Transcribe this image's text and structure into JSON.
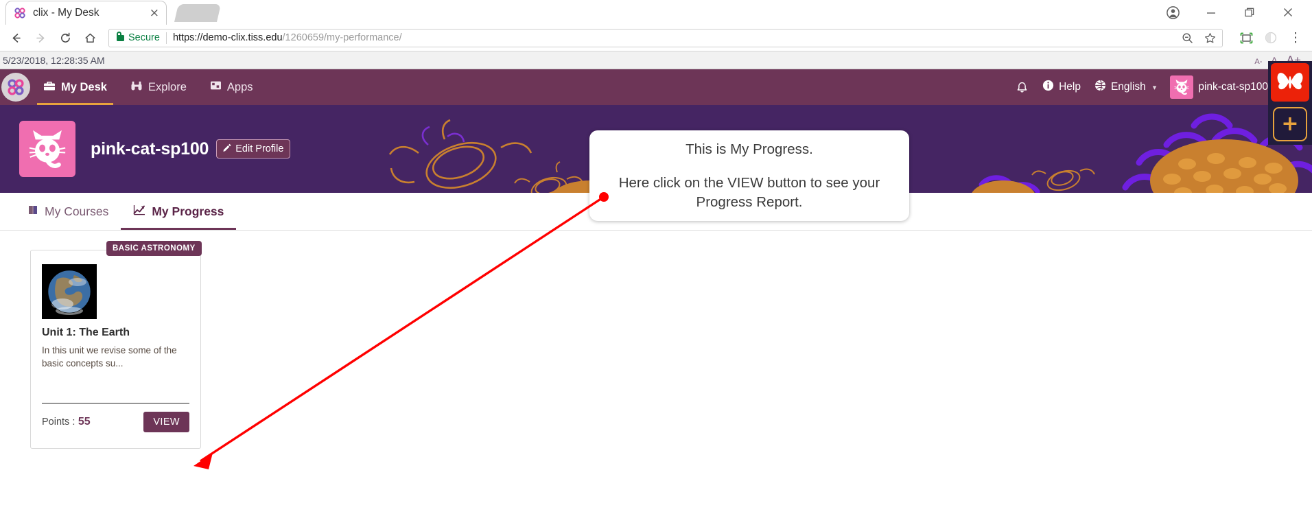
{
  "browser": {
    "tab": {
      "title": "clix - My Desk",
      "favicon": "clix-logo-icon",
      "close": "×"
    },
    "new_tab_button": "new-tab",
    "window_controls": {
      "profile": "●",
      "minimize": "—",
      "maximize": "❐",
      "close": "✕"
    },
    "toolbar": {
      "back": "←",
      "forward": "→",
      "reload": "⟳",
      "home": "⌂",
      "secure_label": "Secure",
      "url_scheme_host": "https://demo-clix.tiss.edu",
      "url_path": "/1260659/my-performance/",
      "url_full": "https://demo-clix.tiss.edu/1260659/my-performance/",
      "zoom_out": "⊖",
      "bookmark": "☆",
      "screenshot": "⬚",
      "extension": "◑",
      "menu": "⋮"
    }
  },
  "status_strip": {
    "timestamp": "5/23/2018, 12:28:35 AM",
    "font_small": "A-",
    "font_normal": "A",
    "font_large": "A+"
  },
  "app_nav": {
    "logo": "clix-logo-icon",
    "items": [
      {
        "label": "My Desk",
        "icon": "briefcase-icon",
        "active": true
      },
      {
        "label": "Explore",
        "icon": "binoculars-icon",
        "active": false
      },
      {
        "label": "Apps",
        "icon": "apps-icon",
        "active": false
      }
    ],
    "notifications_icon": "bell-icon",
    "help_label": "Help",
    "help_icon": "info-icon",
    "language_label": "English",
    "language_icon": "globe-icon",
    "language_caret": "▾",
    "username": "pink-cat-sp100",
    "avatar": "pink-cat-avatar"
  },
  "banner": {
    "avatar": "pink-cat-avatar",
    "profile_name": "pink-cat-sp100",
    "edit_profile_label": "Edit Profile",
    "edit_profile_icon": "pencil-icon",
    "background_color": "#452563"
  },
  "callout": {
    "line1": "This is My Progress.",
    "line2": "Here click on the VIEW button to see your Progress Report.",
    "arrow_color": "#ff0000"
  },
  "page_tabs": [
    {
      "label": "My Courses",
      "icon": "book-icon",
      "active": false
    },
    {
      "label": "My Progress",
      "icon": "chart-line-icon",
      "active": true
    }
  ],
  "course_cards": [
    {
      "badge": "BASIC ASTRONOMY",
      "thumbnail": "earth-image",
      "title": "Unit 1: The Earth",
      "description": "In this unit we revise some of the basic concepts su...",
      "points_label": "Points :",
      "points_value": "55",
      "view_label": "VIEW"
    }
  ],
  "float_widget": {
    "butterfly_icon": "butterfly-icon",
    "add_label": "+"
  },
  "colors": {
    "nav_purple": "#6d3557",
    "banner_purple": "#452563",
    "accent_orange": "#e8a33d",
    "avatar_pink": "#f06eb0",
    "secure_green": "#0b8043",
    "arrow_red": "#ff0000",
    "butterfly_red": "#ec2209"
  }
}
